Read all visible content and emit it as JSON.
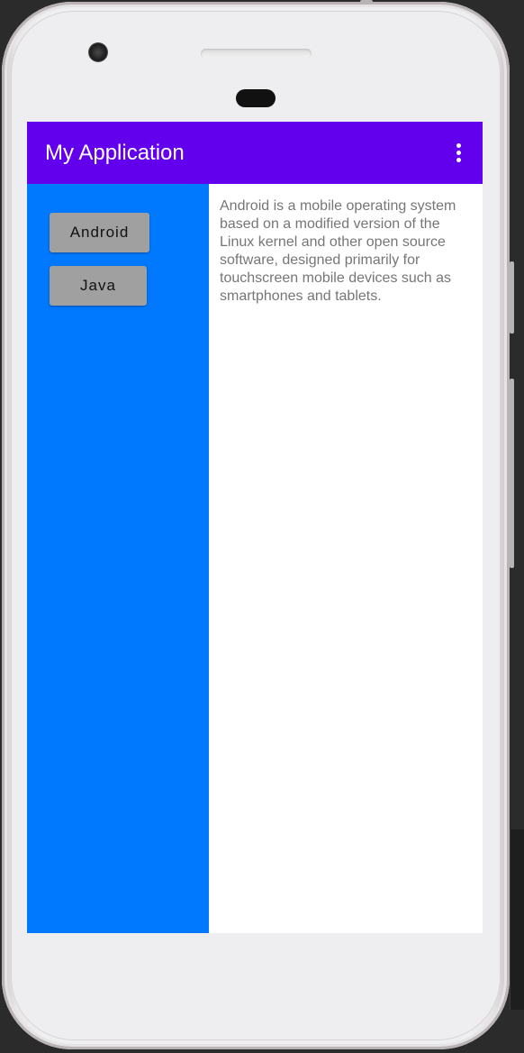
{
  "app": {
    "title": "My Application"
  },
  "toolbar": {
    "overflow_icon": "more-vert-icon"
  },
  "buttons": {
    "android_label": "Android",
    "java_label": "Java"
  },
  "content": {
    "description": "Android is a mobile operating system based on a modified version of the Linux kernel and other open source software, designed primarily for touchscreen mobile devices such as smartphones and tablets."
  },
  "colors": {
    "app_bar": "#6200ee",
    "left_pane": "#0079fe",
    "button": "#a0a0a0",
    "text_secondary": "#767676"
  }
}
